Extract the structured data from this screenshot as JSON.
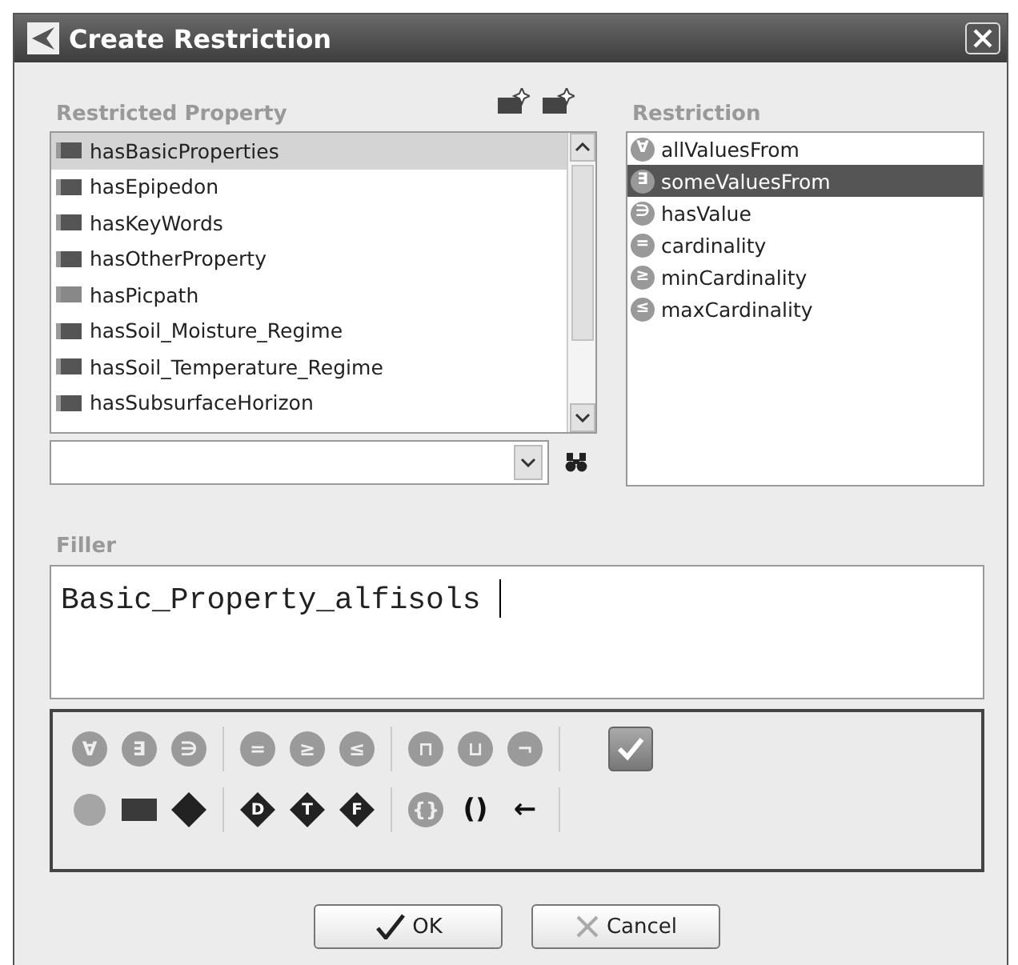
{
  "window": {
    "title": "Create Restriction"
  },
  "restricted_property": {
    "label": "Restricted Property",
    "items": [
      {
        "name": "hasBasicProperties",
        "kind": "object",
        "selected": true
      },
      {
        "name": "hasEpipedon",
        "kind": "object",
        "selected": false
      },
      {
        "name": "hasKeyWords",
        "kind": "object",
        "selected": false
      },
      {
        "name": "hasOtherProperty",
        "kind": "object",
        "selected": false
      },
      {
        "name": "hasPicpath",
        "kind": "data",
        "selected": false
      },
      {
        "name": "hasSoil_Moisture_Regime",
        "kind": "object",
        "selected": false
      },
      {
        "name": "hasSoil_Temperature_Regime",
        "kind": "object",
        "selected": false
      },
      {
        "name": "hasSubsurfaceHorizon",
        "kind": "object",
        "selected": false
      }
    ]
  },
  "restriction": {
    "label": "Restriction",
    "items": [
      {
        "glyph": "∀",
        "name": "allValuesFrom",
        "selected": false
      },
      {
        "glyph": "∃",
        "name": "someValuesFrom",
        "selected": true
      },
      {
        "glyph": "∋",
        "name": "hasValue",
        "selected": false
      },
      {
        "glyph": "=",
        "name": "cardinality",
        "selected": false
      },
      {
        "glyph": "≥",
        "name": "minCardinality",
        "selected": false
      },
      {
        "glyph": "≤",
        "name": "maxCardinality",
        "selected": false
      }
    ]
  },
  "filler": {
    "label": "Filler",
    "value": "Basic_Property_alfisols "
  },
  "toolbar": [
    [
      [
        {
          "kind": "circle",
          "glyph": "∀",
          "disabled": true
        },
        {
          "kind": "circle",
          "glyph": "∃",
          "disabled": true
        },
        {
          "kind": "circle",
          "glyph": "∋",
          "disabled": true
        }
      ],
      [
        {
          "kind": "circle",
          "glyph": "=",
          "disabled": true
        },
        {
          "kind": "circle",
          "glyph": "≥",
          "disabled": true
        },
        {
          "kind": "circle",
          "glyph": "≤",
          "disabled": true
        }
      ],
      [
        {
          "kind": "circle",
          "glyph": "⊓",
          "disabled": true
        },
        {
          "kind": "circle",
          "glyph": "⊔",
          "disabled": true
        },
        {
          "kind": "circle",
          "glyph": "¬",
          "disabled": true
        }
      ],
      [
        {
          "kind": "check",
          "disabled": false
        }
      ]
    ],
    [
      [
        {
          "kind": "dot",
          "disabled": true
        },
        {
          "kind": "block",
          "disabled": false
        },
        {
          "kind": "rhombus",
          "disabled": false
        }
      ],
      [
        {
          "kind": "diamond",
          "glyph": "D",
          "disabled": false
        },
        {
          "kind": "diamond",
          "glyph": "T",
          "disabled": false
        },
        {
          "kind": "diamond",
          "glyph": "F",
          "disabled": false
        }
      ],
      [
        {
          "kind": "circle",
          "glyph": "{}",
          "disabled": true
        },
        {
          "kind": "plain",
          "glyph": "()",
          "disabled": false
        },
        {
          "kind": "plain",
          "glyph": "←",
          "disabled": false
        }
      ]
    ]
  ],
  "buttons": [
    {
      "label": "OK",
      "kind": "ok"
    },
    {
      "label": "Cancel",
      "kind": "cancel"
    }
  ]
}
